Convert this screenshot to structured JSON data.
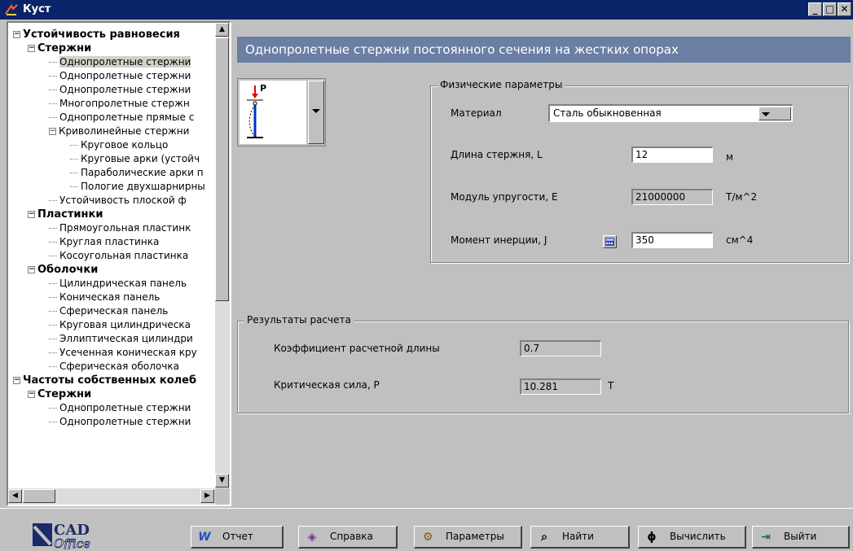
{
  "window": {
    "title": "Куст"
  },
  "tree": {
    "nodes": [
      {
        "label": "Устойчивость равновесия",
        "level": 0,
        "expander": "⊟",
        "bold": true
      },
      {
        "label": "Стержни",
        "level": 1,
        "expander": "⊟",
        "bold": true
      },
      {
        "label": "Однопролетные стержни",
        "level": 2,
        "selected": true
      },
      {
        "label": "Однопролетные стержни",
        "level": 2
      },
      {
        "label": "Однопролетные стержни",
        "level": 2
      },
      {
        "label": "Многопролетные стержн",
        "level": 2
      },
      {
        "label": "Однопролетные прямые с",
        "level": 2
      },
      {
        "label": "Криволинейные стержни",
        "level": 2,
        "expander": "⊟"
      },
      {
        "label": "Круговое кольцо",
        "level": 3
      },
      {
        "label": "Круговые арки (устойч",
        "level": 3
      },
      {
        "label": "Параболические арки п",
        "level": 3
      },
      {
        "label": "Пологие двухшарнирны",
        "level": 3
      },
      {
        "label": "Устойчивость плоской ф",
        "level": 2
      },
      {
        "label": "Пластинки",
        "level": 1,
        "expander": "⊟",
        "bold": true
      },
      {
        "label": "Прямоугольная пластинк",
        "level": 2
      },
      {
        "label": "Круглая пластинка",
        "level": 2
      },
      {
        "label": "Косоугольная пластинка",
        "level": 2
      },
      {
        "label": "Оболочки",
        "level": 1,
        "expander": "⊟",
        "bold": true
      },
      {
        "label": "Цилиндрическая панель",
        "level": 2
      },
      {
        "label": "Коническая панель",
        "level": 2
      },
      {
        "label": "Сферическая панель",
        "level": 2
      },
      {
        "label": "Круговая цилиндрическа",
        "level": 2
      },
      {
        "label": "Эллиптическая цилиндри",
        "level": 2
      },
      {
        "label": "Усеченная коническая кру",
        "level": 2
      },
      {
        "label": "Сферическая оболочка",
        "level": 2
      },
      {
        "label": "Частоты собственных колеб",
        "level": 0,
        "expander": "⊟",
        "bold": true
      },
      {
        "label": "Стержни",
        "level": 1,
        "expander": "⊟",
        "bold": true
      },
      {
        "label": "Однопролетные стержни",
        "level": 2
      },
      {
        "label": "Однопролетные стержни",
        "level": 2
      }
    ]
  },
  "header": {
    "title": "Однопролетные стержни постоянного сечения на жестких опорах"
  },
  "scheme": {
    "load_label": "P"
  },
  "physical": {
    "legend": "Физические параметры",
    "material_label": "Материал",
    "material_value": "Сталь обыкновенная",
    "length_label": "Длина стержня, L",
    "length_value": "12",
    "length_unit": "м",
    "modulus_label": "Модуль упругости, E",
    "modulus_value": "21000000",
    "modulus_unit": "Т/м^2",
    "inertia_label": "Момент инерции, J",
    "inertia_value": "350",
    "inertia_unit": "см^4"
  },
  "results": {
    "legend": "Результаты расчета",
    "coef_label": "Коэффициент расчетной длины",
    "coef_value": "0.7",
    "force_label": "Критическая сила, P",
    "force_value": "10.281",
    "force_unit": "Т"
  },
  "logo": {
    "top": "CAD",
    "bottom": "Office"
  },
  "toolbar": {
    "report": "Отчет",
    "help": "Справка",
    "params": "Параметры",
    "find": "Найти",
    "compute": "Вычислить",
    "exit": "Выйти"
  },
  "colors": {
    "titlebar": "#0a246a",
    "header": "#6b7ea3",
    "face": "#c0c0c0"
  }
}
